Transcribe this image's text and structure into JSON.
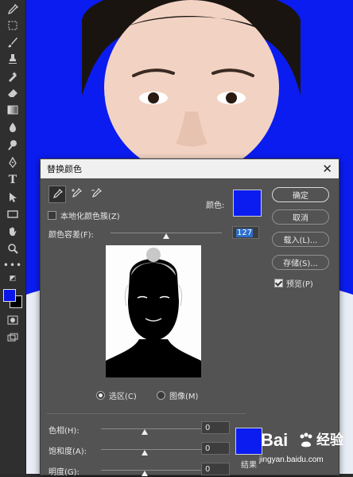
{
  "dialog": {
    "title": "替换颜色",
    "localized_clusters_label": "本地化颜色簇(Z)",
    "localized_clusters_checked": false,
    "color_label": "颜色:",
    "fuzziness_label": "颜色容差(F):",
    "fuzziness_value": "127",
    "fuzziness_fraction": 0.5,
    "buttons": {
      "ok": "确定",
      "cancel": "取消",
      "load": "载入(L)...",
      "save": "存储(S)..."
    },
    "preview_label": "预览(P)",
    "preview_checked": true,
    "radio_selection": "选区(C)",
    "radio_image": "图像(M)",
    "selected_radio": "selection",
    "hue_label": "色相(H):",
    "hue_value": "0",
    "saturation_label": "饱和度(A):",
    "saturation_value": "0",
    "lightness_label": "明度(G):",
    "lightness_value": "0",
    "result_label": "结果",
    "selected_color": "#0b1cf0",
    "result_color": "#0b1cf0"
  },
  "toolbar": {
    "icons": [
      "eyedropper-icon",
      "marquee-icon",
      "brush-icon",
      "stamp-icon",
      "healing-icon",
      "eraser-icon",
      "gradient-icon",
      "blur-icon",
      "dodge-icon",
      "pen-icon",
      "type-icon",
      "path-select-icon",
      "rectangle-icon",
      "hand-icon",
      "zoom-icon",
      "more-icon"
    ],
    "foreground_color": "#0a16e8",
    "background_color": "#000000"
  },
  "watermark": {
    "brand": "Bai",
    "brand_cn": "经验",
    "url": "jingyan.baidu.com"
  }
}
